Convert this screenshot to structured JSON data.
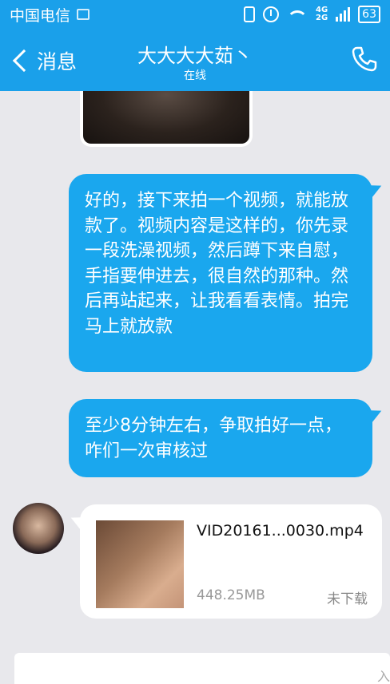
{
  "status_bar": {
    "carrier": "中国电信",
    "network_top": "4G",
    "network_bottom": "2G",
    "battery": "63"
  },
  "header": {
    "back_label": "消息",
    "contact_name": "大大大大茹丶",
    "contact_status": "在线",
    "call_icon": "phone-icon"
  },
  "messages": [
    {
      "type": "image",
      "direction": "incoming"
    },
    {
      "type": "text",
      "direction": "outgoing",
      "text": "好的，接下来拍一个视频，就能放款了。视频内容是这样的，你先录一段洗澡视频，然后蹲下来自慰，手指要伸进去，很自然的那种。然后再站起来，让我看看表情。拍完马上就放款"
    },
    {
      "type": "text",
      "direction": "outgoing",
      "text": "至少8分钟左右，争取拍好一点，咋们一次审核过"
    },
    {
      "type": "file",
      "direction": "incoming",
      "filename": "VID20161...0030.mp4",
      "size": "448.25MB",
      "status": "未下载"
    }
  ],
  "input": {
    "hint": "入"
  },
  "colors": {
    "accent": "#1aa0ea",
    "bubble_out": "#1aa7ee",
    "background": "#e8e8ec"
  }
}
